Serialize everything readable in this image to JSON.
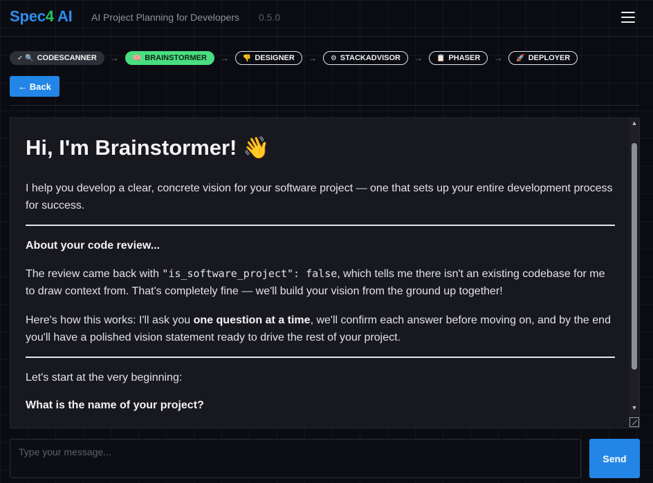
{
  "header": {
    "logo_part1": "Spec",
    "logo_part2": "4",
    "logo_part3": " AI",
    "tagline": "AI Project Planning for Developers",
    "version": "0.5.0"
  },
  "steps": [
    {
      "icon": "✓ 🔍",
      "label": "CODESCANNER",
      "state": "done"
    },
    {
      "icon": "🧠",
      "label": "BRAINSTORMER",
      "state": "active"
    },
    {
      "icon": "👎",
      "label": "DESIGNER",
      "state": "todo"
    },
    {
      "icon": "⚙",
      "label": "STACKADVISOR",
      "state": "todo"
    },
    {
      "icon": "📋",
      "label": "PHASER",
      "state": "todo"
    },
    {
      "icon": "🚀",
      "label": "DEPLOYER",
      "state": "todo"
    }
  ],
  "step_separator": "→",
  "back_label": "← Back",
  "message": {
    "title": "Hi, I'm Brainstormer! 👋",
    "intro": "I help you develop a clear, concrete vision for your software project — one that sets up your entire development process for success.",
    "review_heading": "About your code review...",
    "review_pre": "The review came back with ",
    "review_code": "\"is_software_project\": false",
    "review_post": ", which tells me there isn't an existing codebase for me to draw context from. That's completely fine — we'll build your vision from the ground up together!",
    "how_pre": "Here's how this works: I'll ask you ",
    "how_bold": "one question at a time",
    "how_post": ", we'll confirm each answer before moving on, and by the end you'll have a polished vision statement ready to drive the rest of your project.",
    "start": "Let's start at the very beginning:",
    "question": "What is the name of your project?"
  },
  "scrollbar": {
    "up_arrow": "▲",
    "down_arrow": "▼"
  },
  "input": {
    "placeholder": "Type your message...",
    "value": ""
  },
  "send_label": "Send",
  "colors": {
    "accent": "#2386e6",
    "active_step": "#4ade80",
    "logo_green": "#22c55e"
  }
}
